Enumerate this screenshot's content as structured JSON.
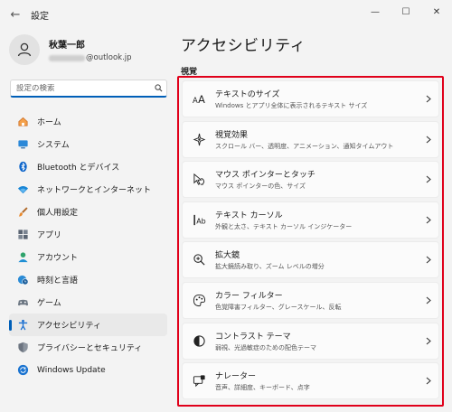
{
  "window": {
    "app_title": "設定"
  },
  "profile": {
    "name": "秋葉一郎",
    "email_domain": "@outlook.jp"
  },
  "search": {
    "placeholder": "設定の検索"
  },
  "sidebar": {
    "items": [
      {
        "label": "ホーム",
        "icon": "home-icon"
      },
      {
        "label": "システム",
        "icon": "system-icon"
      },
      {
        "label": "Bluetooth とデバイス",
        "icon": "bluetooth-icon"
      },
      {
        "label": "ネットワークとインターネット",
        "icon": "wifi-icon"
      },
      {
        "label": "個人用設定",
        "icon": "brush-icon"
      },
      {
        "label": "アプリ",
        "icon": "apps-icon"
      },
      {
        "label": "アカウント",
        "icon": "account-icon"
      },
      {
        "label": "時刻と言語",
        "icon": "globe-clock-icon"
      },
      {
        "label": "ゲーム",
        "icon": "gamepad-icon"
      },
      {
        "label": "アクセシビリティ",
        "icon": "accessibility-icon",
        "selected": true
      },
      {
        "label": "プライバシーとセキュリティ",
        "icon": "shield-icon"
      },
      {
        "label": "Windows Update",
        "icon": "update-icon"
      }
    ]
  },
  "main": {
    "title": "アクセシビリティ",
    "section": "視覚",
    "cards": [
      {
        "title": "テキストのサイズ",
        "desc": "Windows とアプリ全体に表示されるテキスト サイズ",
        "icon": "text-size-icon"
      },
      {
        "title": "視覚効果",
        "desc": "スクロール バー、透明度、アニメーション、通知タイムアウト",
        "icon": "visual-effects-icon"
      },
      {
        "title": "マウス ポインターとタッチ",
        "desc": "マウス ポインターの色、サイズ",
        "icon": "mouse-pointer-icon"
      },
      {
        "title": "テキスト カーソル",
        "desc": "外観と太さ、テキスト カーソル インジケーター",
        "icon": "text-cursor-icon"
      },
      {
        "title": "拡大鏡",
        "desc": "拡大鏡読み取り、ズーム レベルの増分",
        "icon": "magnifier-icon"
      },
      {
        "title": "カラー フィルター",
        "desc": "色覚障害フィルター、グレースケール、反転",
        "icon": "color-filter-icon"
      },
      {
        "title": "コントラスト テーマ",
        "desc": "弱視、光過敏症のための配色テーマ",
        "icon": "contrast-icon"
      },
      {
        "title": "ナレーター",
        "desc": "音声、詳細度、キーボード、点字",
        "icon": "narrator-icon"
      }
    ]
  },
  "colors": {
    "accent": "#005fb8",
    "highlight": "#e0001a"
  }
}
